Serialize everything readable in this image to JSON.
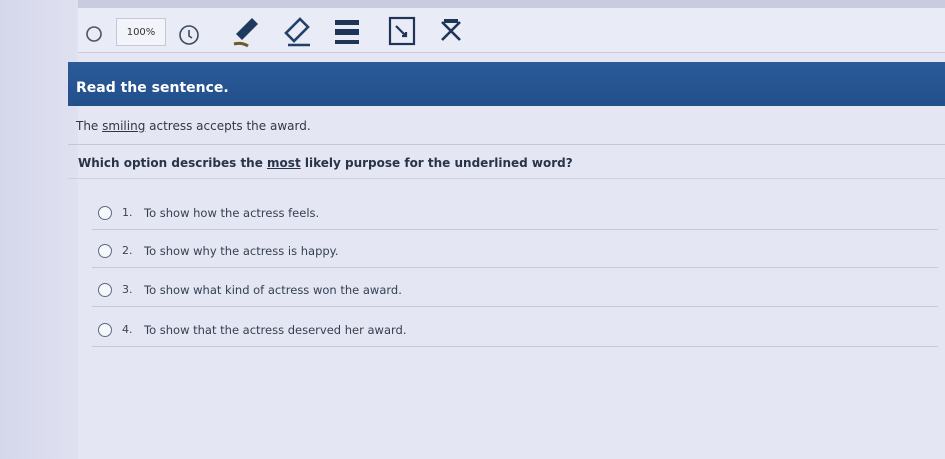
{
  "toolbar": {
    "zoom_label": "100%",
    "tools": [
      {
        "icon": "search-icon"
      },
      {
        "icon": "line-reader-icon"
      },
      {
        "icon": "highlighter-icon"
      },
      {
        "icon": "eraser-icon"
      },
      {
        "icon": "answer-masking-icon"
      },
      {
        "icon": "notepad-icon"
      },
      {
        "icon": "option-eliminator-icon"
      }
    ]
  },
  "header": {
    "title": "Read the sentence."
  },
  "passage": {
    "before": "The ",
    "underlined": "smiling",
    "after": " actress accepts the award."
  },
  "question": {
    "before": "Which option describes the ",
    "emphasis": "most",
    "after": " likely purpose for the underlined word?"
  },
  "options": [
    {
      "number": "1.",
      "text": "To show how the actress feels."
    },
    {
      "number": "2.",
      "text": "To show why the actress is happy."
    },
    {
      "number": "3.",
      "text": "To show what kind of actress won the award."
    },
    {
      "number": "4.",
      "text": "To show that the actress deserved her award."
    }
  ]
}
